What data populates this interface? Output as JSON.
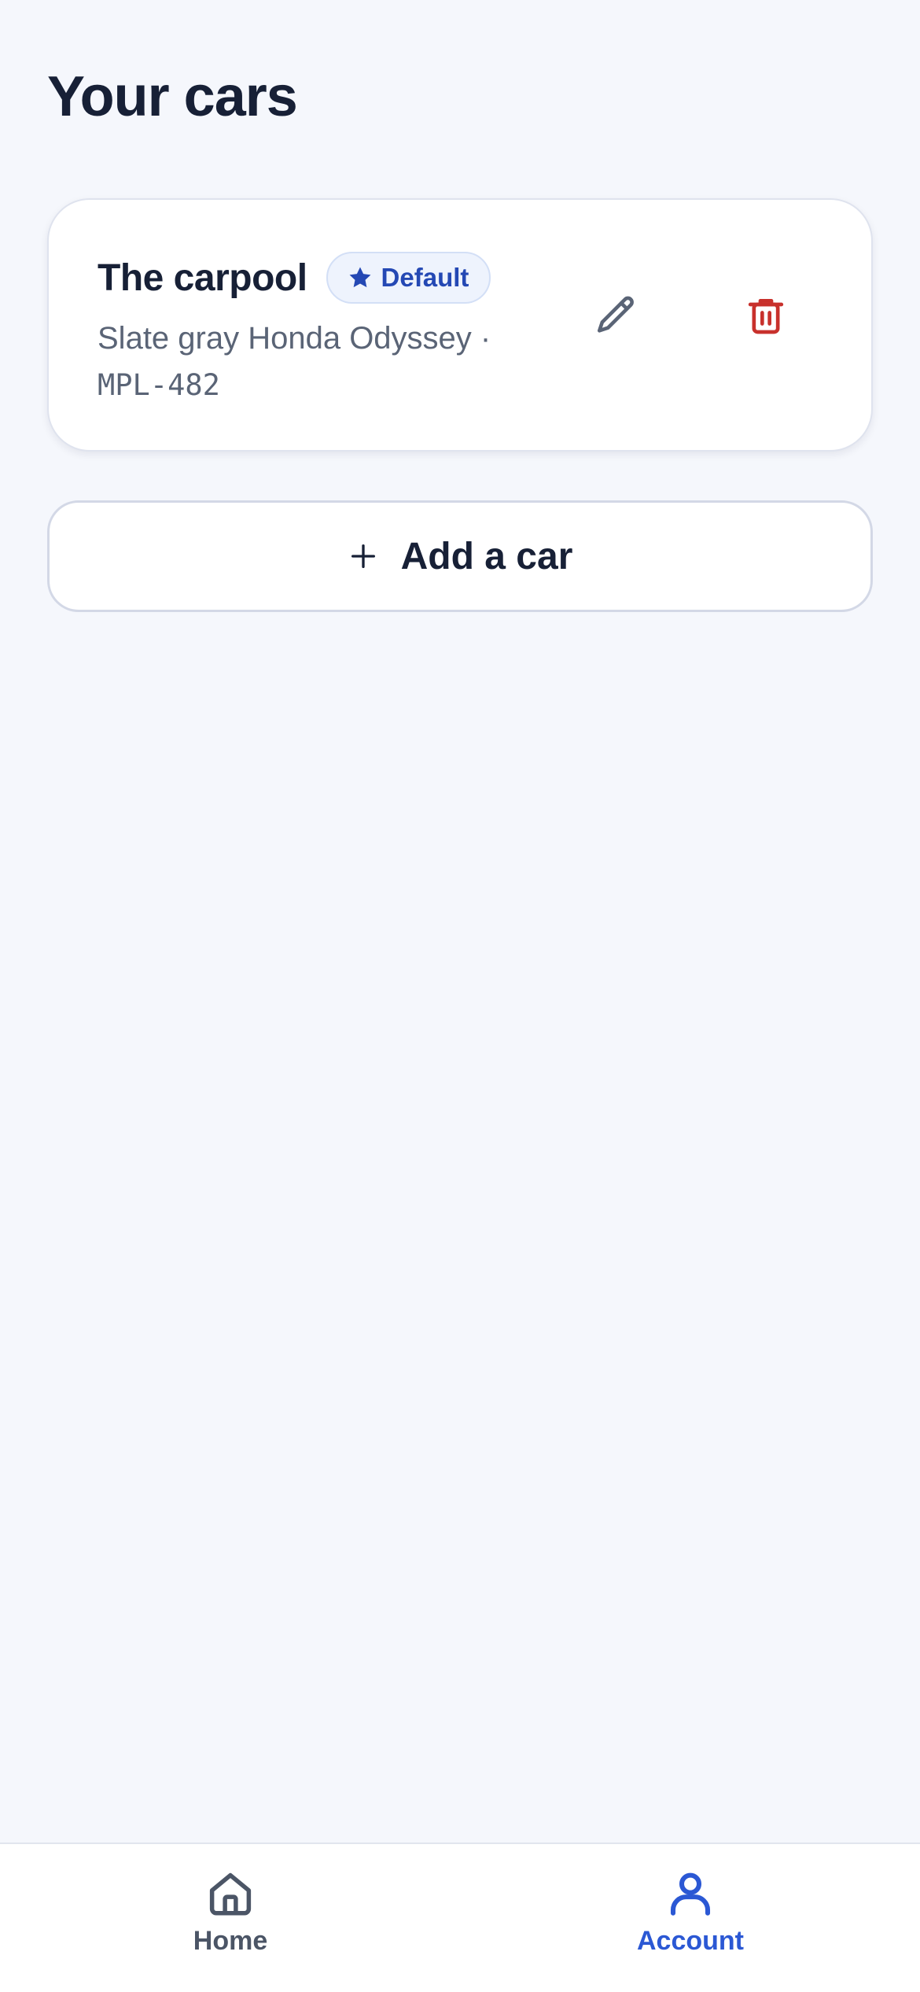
{
  "page": {
    "title": "Your cars"
  },
  "cars": [
    {
      "name": "The carpool",
      "badge": "Default",
      "description": "Slate gray Honda Odyssey ·",
      "plate": "MPL-482"
    }
  ],
  "actions": {
    "add_car_label": "Add a car"
  },
  "icons": {
    "badge": "star-icon",
    "edit": "pencil-icon",
    "delete": "trash-icon",
    "add": "plus-icon",
    "home": "home-icon",
    "account": "user-icon"
  },
  "bottom_nav": {
    "items": [
      {
        "label": "Home",
        "active": false
      },
      {
        "label": "Account",
        "active": true
      }
    ]
  },
  "colors": {
    "background": "#f5f7fc",
    "text_primary": "#172036",
    "badge_text": "#2448b4",
    "badge_bg": "#eef3fd",
    "delete_red": "#c8312c",
    "nav_active": "#2b58d4",
    "nav_inactive": "#4b5566"
  }
}
